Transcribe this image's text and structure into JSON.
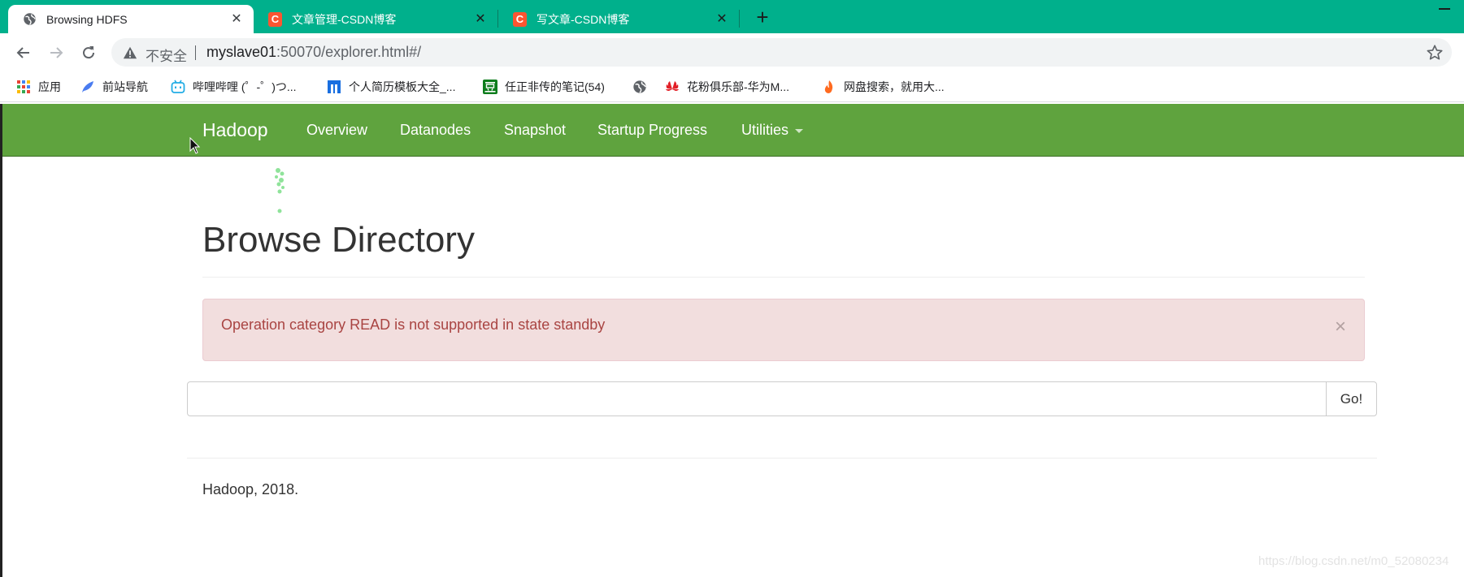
{
  "browser": {
    "tabs": [
      {
        "title": "Browsing HDFS",
        "icon": "globe-icon",
        "active": true
      },
      {
        "title": "文章管理-CSDN博客",
        "icon": "csdn-icon",
        "active": false
      },
      {
        "title": "写文章-CSDN博客",
        "icon": "csdn-icon",
        "active": false
      }
    ],
    "address": {
      "security_label": "不安全",
      "host": "myslave01",
      "rest": ":50070/explorer.html#/"
    },
    "bookmarks": [
      {
        "label": "应用",
        "icon": "apps-grid-icon"
      },
      {
        "label": "前站导航",
        "icon": "feather-icon"
      },
      {
        "label": "哔哩哔哩 (゜-゜)つ...",
        "icon": "bilibili-icon"
      },
      {
        "label": "个人简历模板大全_...",
        "icon": "resume-icon"
      },
      {
        "label": "任正非传的笔记(54)",
        "icon": "douban-icon"
      },
      {
        "label": "",
        "icon": "globe-icon"
      },
      {
        "label": "花粉俱乐部-华为M...",
        "icon": "huawei-icon"
      },
      {
        "label": "网盘搜索，就用大...",
        "icon": "fire-icon"
      }
    ],
    "colors": {
      "tabstrip": "#00b08c"
    }
  },
  "navbar": {
    "brand": "Hadoop",
    "links": [
      "Overview",
      "Datanodes",
      "Snapshot",
      "Startup Progress",
      "Utilities"
    ],
    "color": "#5fa33e"
  },
  "main": {
    "title": "Browse Directory",
    "alert": {
      "message": "Operation category READ is not supported in state standby",
      "close": "×"
    },
    "search": {
      "value": "",
      "placeholder": "",
      "button": "Go!"
    },
    "footer": "Hadoop, 2018."
  },
  "watermark": "https://blog.csdn.net/m0_52080234"
}
